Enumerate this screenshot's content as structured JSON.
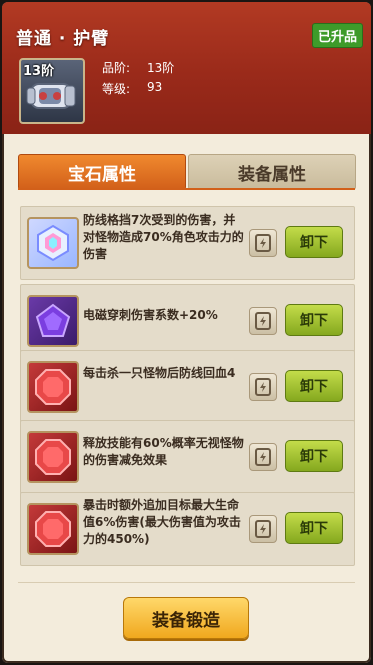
{
  "header": {
    "title": "普通 · 护臂",
    "badge": "已升品",
    "item": {
      "tier": "13阶",
      "icon": "armguard-icon"
    },
    "stats": {
      "grade_label": "品阶:",
      "grade_value": "13阶",
      "level_label": "等级:",
      "level_value": "93"
    }
  },
  "tabs": {
    "gem": "宝石属性",
    "equip": "装备属性",
    "active": "gem"
  },
  "gems": [
    {
      "type": "rainbow",
      "icon": "rainbow-gem-icon",
      "desc": "防线格挡7次受到的伤害，并对怪物造成70%角色攻击力的伤害",
      "unload": "卸下"
    },
    {
      "type": "purple",
      "icon": "purple-gem-icon",
      "desc": "电磁穿刺伤害系数+20%",
      "unload": "卸下"
    },
    {
      "type": "red",
      "icon": "red-gem-icon",
      "desc": "每击杀一只怪物后防线回血4",
      "unload": "卸下"
    },
    {
      "type": "red",
      "icon": "red-gem-icon",
      "desc": "释放技能有60%概率无视怪物的伤害减免效果",
      "unload": "卸下"
    },
    {
      "type": "red",
      "icon": "red-gem-icon",
      "desc": "暴击时额外追加目标最大生命值6%伤害(最大伤害值为攻击力的450%)",
      "unload": "卸下"
    }
  ],
  "footer": {
    "forge": "装备锻造"
  },
  "colors": {
    "header": "#9a2a1a",
    "accent": "#d2601a",
    "unload": "#85a81e",
    "forge": "#f0a81e"
  }
}
